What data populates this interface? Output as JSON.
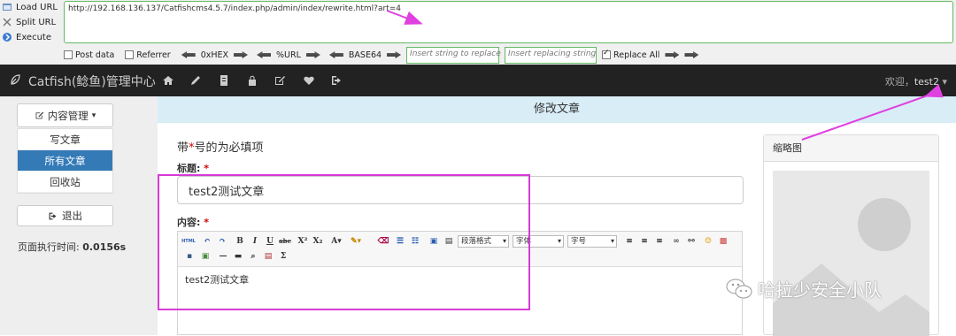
{
  "hackbar": {
    "load_url": "Load URL",
    "split_url": "Split URL",
    "execute": "Execute",
    "url_value": "http://192.168.136.137/Catfishcms4.5.7/index.php/admin/index/rewrite.html?art=4",
    "post_data": "Post data",
    "referrer": "Referrer",
    "hex": "0xHEX",
    "url_enc": "%URL",
    "base64": "BASE64",
    "replace_placeholder": "Insert string to replace",
    "replacing_placeholder": "Insert replacing string",
    "replace_all": "Replace All"
  },
  "topnav": {
    "brand": "Catfish(鲶鱼)管理中心",
    "welcome_prefix": "欢迎，",
    "username": "test2"
  },
  "sidebar": {
    "content_mgmt": "内容管理",
    "items": [
      {
        "label": "写文章"
      },
      {
        "label": "所有文章"
      },
      {
        "label": "回收站"
      }
    ],
    "logout": "退出",
    "exec_label": "页面执行时间:",
    "exec_value": "0.0156s"
  },
  "main": {
    "header": "修改文章",
    "required_prefix": "带",
    "required_star": "*",
    "required_suffix": "号的为必填项",
    "title_label": "标题:",
    "title_value": "test2测试文章",
    "content_label": "内容:",
    "editor_body": "test2测试文章",
    "toolbar": {
      "html": "HTML",
      "para_format": "段落格式",
      "font": "字体",
      "font_size": "字号"
    }
  },
  "thumbnail": {
    "title": "缩略图"
  },
  "watermark": {
    "text": "哈拉少安全小队"
  },
  "colors": {
    "highlight": "#d63bd6",
    "nav_bg": "#222222",
    "active_blue": "#337ab7",
    "header_bg": "#d9edf7"
  }
}
